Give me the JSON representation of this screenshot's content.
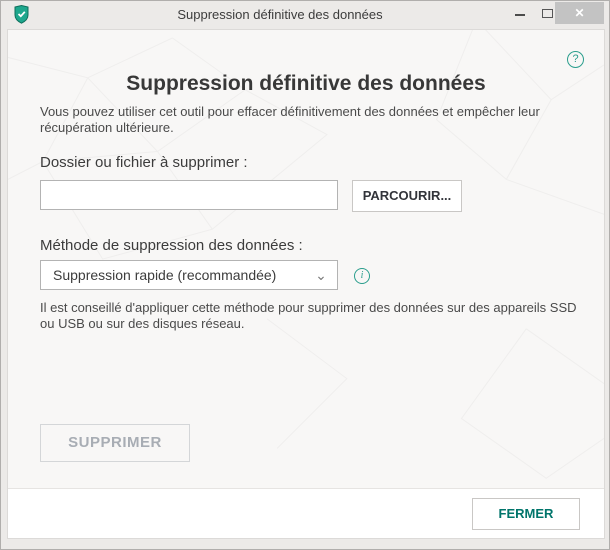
{
  "titlebar": {
    "title": "Suppression définitive des données"
  },
  "icons": {
    "app_shield": "shield-check",
    "minimize": "minimize-bar",
    "maximize": "maximize-box",
    "close": "✕",
    "help": "?",
    "info": "i",
    "chevron_down": "⌄"
  },
  "main": {
    "heading": "Suppression définitive des données",
    "description": "Vous pouvez utiliser cet outil pour effacer définitivement des données et empêcher leur récupération ultérieure."
  },
  "form": {
    "file_label": "Dossier ou fichier à supprimer :",
    "file_value": "",
    "browse_label": "PARCOURIR...",
    "method_label": "Méthode de suppression des données :",
    "method_value": "Suppression rapide (recommandée)",
    "method_note": "Il est conseillé d'appliquer cette méthode pour supprimer des données sur des appareils SSD ou USB ou sur des disques réseau.",
    "delete_label": "SUPPRIMER",
    "delete_disabled": true
  },
  "footer": {
    "close_label": "FERMER"
  },
  "colors": {
    "accent_teal": "#2b9e8d",
    "teal_button_text": "#00756b",
    "shield_fill": "#1ea78d",
    "shield_border": "#0e6f5c",
    "disabled_text": "#a8adb4",
    "titlebar_bg": "#eceae8",
    "panel_bg": "#f8f7f6",
    "close_button_bg": "#c3c3c3"
  }
}
